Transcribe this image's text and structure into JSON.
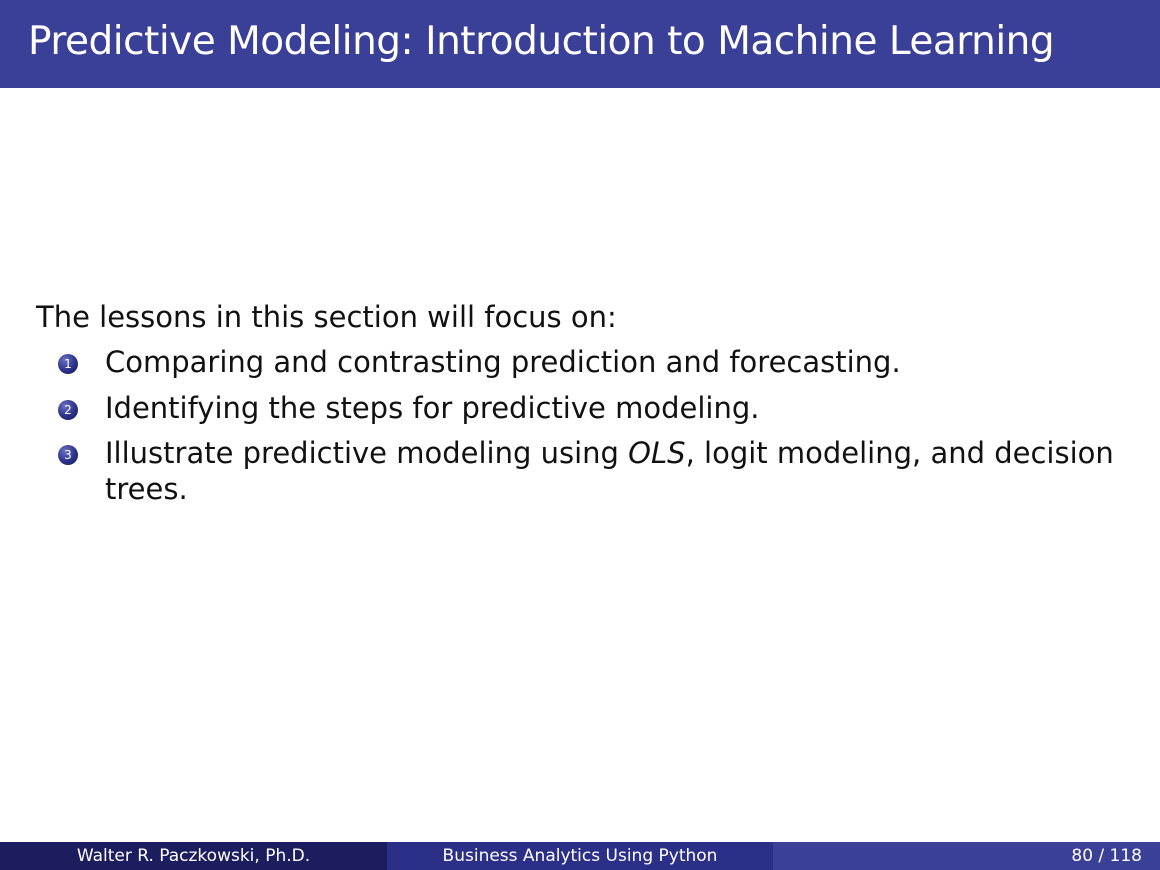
{
  "slide": {
    "title": "Predictive Modeling: Introduction to Machine Learning",
    "intro": "The lessons in this section will focus on:",
    "items": [
      {
        "number": "1",
        "text": "Comparing and contrasting prediction and forecasting."
      },
      {
        "number": "2",
        "text": "Identifying the steps for predictive modeling."
      },
      {
        "number": "3",
        "text_before": "Illustrate predictive modeling using ",
        "text_emphasis": "OLS",
        "text_after": ", logit modeling, and decision trees."
      }
    ]
  },
  "footer": {
    "author": "Walter R. Paczkowski, Ph.D.",
    "course": "Business Analytics Using Python",
    "page": "80 / 118"
  },
  "colors": {
    "title_bar": "#3a3f98",
    "footer_left": "#1b1d5e",
    "footer_center": "#2b2f87",
    "footer_right": "#3a3f98"
  }
}
